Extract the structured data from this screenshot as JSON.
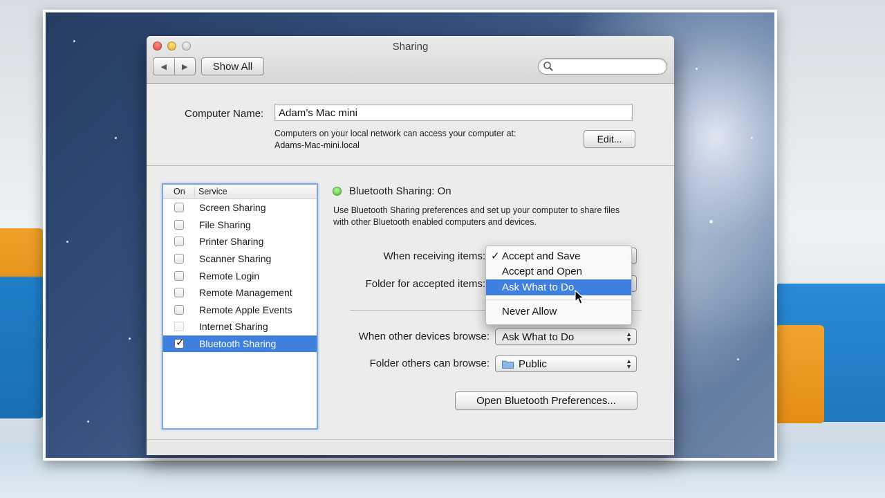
{
  "window": {
    "title": "Sharing",
    "back_glyph": "◀",
    "forward_glyph": "▶",
    "show_all_label": "Show All",
    "search_placeholder": ""
  },
  "computer": {
    "name_label": "Computer Name:",
    "name_value": "Adam’s Mac mini",
    "network_text_line1": "Computers on your local network can access your computer at:",
    "network_text_line2": "Adams-Mac-mini.local",
    "edit_label": "Edit..."
  },
  "service_list": {
    "header_on": "On",
    "header_service": "Service",
    "items": [
      {
        "label": "Screen Sharing",
        "checked": false
      },
      {
        "label": "File Sharing",
        "checked": false
      },
      {
        "label": "Printer Sharing",
        "checked": false
      },
      {
        "label": "Scanner Sharing",
        "checked": false
      },
      {
        "label": "Remote Login",
        "checked": false
      },
      {
        "label": "Remote Management",
        "checked": false
      },
      {
        "label": "Remote Apple Events",
        "checked": false
      },
      {
        "label": "Internet Sharing",
        "checked": false
      },
      {
        "label": "Bluetooth Sharing",
        "checked": true,
        "selected": true
      }
    ]
  },
  "bluetooth": {
    "status_text": "Bluetooth Sharing: On",
    "status_color": "#39b72a",
    "description_line1": "Use Bluetooth Sharing preferences and set up your computer to share files",
    "description_line2": "with other Bluetooth enabled computers and devices.",
    "receiving_label": "When receiving items:",
    "accepted_folder_label": "Folder for accepted items:",
    "browse_label": "When other devices browse:",
    "browse_value": "Ask What to Do",
    "browse_folder_label": "Folder others can browse:",
    "browse_folder_value": "Public",
    "open_prefs_label": "Open Bluetooth Preferences..."
  },
  "receiving_menu": {
    "checked_glyph": "✓",
    "options": [
      {
        "label": "Accept and Save",
        "checked": true
      },
      {
        "label": "Accept and Open"
      },
      {
        "label": "Ask What to Do",
        "highlighted": true
      },
      {
        "label": "Never Allow"
      }
    ]
  },
  "colors": {
    "selection": "#3f80de",
    "menu_highlight": "#3f7fe0"
  }
}
